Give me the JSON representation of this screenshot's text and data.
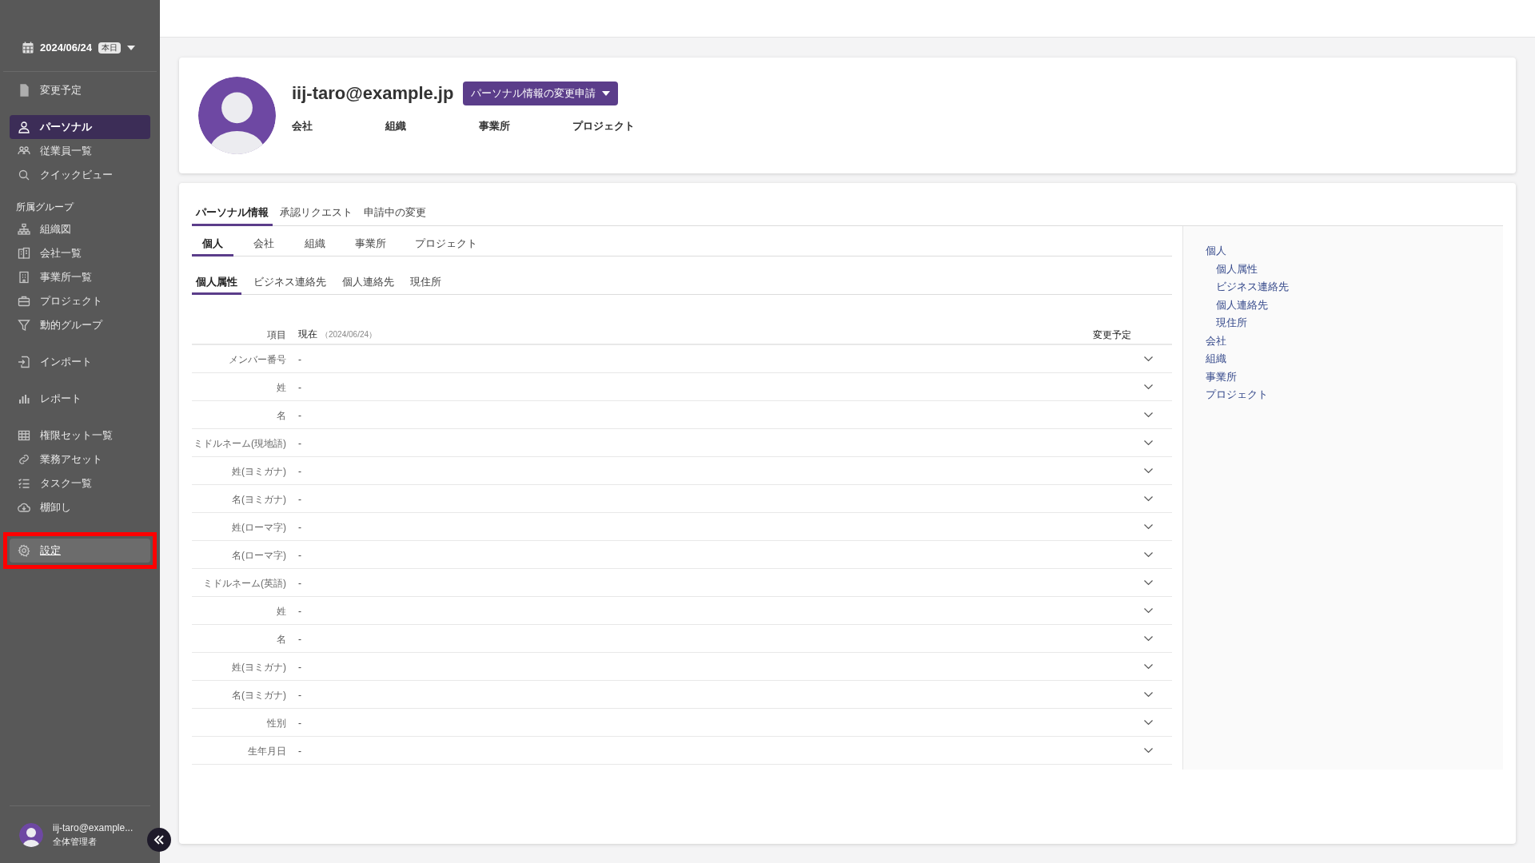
{
  "sidebar": {
    "date": "2024/06/24",
    "today_badge": "本日",
    "groups": [
      {
        "items": [
          {
            "label": "変更予定",
            "kind": "document",
            "selected": false,
            "highlighted": false
          }
        ]
      },
      {
        "items": [
          {
            "label": "パーソナル",
            "kind": "person",
            "selected": true,
            "highlighted": false
          },
          {
            "label": "従業員一覧",
            "kind": "people",
            "selected": false,
            "highlighted": false
          },
          {
            "label": "クイックビュー",
            "kind": "search",
            "selected": false,
            "highlighted": false
          }
        ]
      },
      {
        "heading": "所属グループ",
        "items": [
          {
            "label": "組織図",
            "kind": "org",
            "selected": false,
            "highlighted": false
          },
          {
            "label": "会社一覧",
            "kind": "buildings",
            "selected": false,
            "highlighted": false
          },
          {
            "label": "事業所一覧",
            "kind": "building",
            "selected": false,
            "highlighted": false
          },
          {
            "label": "プロジェクト",
            "kind": "briefcase",
            "selected": false,
            "highlighted": false
          },
          {
            "label": "動的グループ",
            "kind": "filter",
            "selected": false,
            "highlighted": false
          }
        ]
      },
      {
        "items": [
          {
            "label": "インポート",
            "kind": "import",
            "selected": false,
            "highlighted": false
          }
        ]
      },
      {
        "items": [
          {
            "label": "レポート",
            "kind": "chart",
            "selected": false,
            "highlighted": false
          }
        ]
      },
      {
        "items": [
          {
            "label": "権限セット一覧",
            "kind": "grid",
            "selected": false,
            "highlighted": false
          },
          {
            "label": "業務アセット",
            "kind": "link",
            "selected": false,
            "highlighted": false
          },
          {
            "label": "タスク一覧",
            "kind": "tasks",
            "selected": false,
            "highlighted": false
          },
          {
            "label": "棚卸し",
            "kind": "cloud",
            "selected": false,
            "highlighted": false
          }
        ]
      },
      {
        "items": [
          {
            "label": "設定",
            "kind": "gear",
            "selected": false,
            "highlighted": true
          }
        ]
      }
    ],
    "user": {
      "name": "iij-taro@example...",
      "role": "全体管理者"
    }
  },
  "profile": {
    "email": "iij-taro@example.jp",
    "request_button": "パーソナル情報の変更申請",
    "fields": [
      "会社",
      "組織",
      "事業所",
      "プロジェクト"
    ]
  },
  "tabs": [
    {
      "label": "パーソナル情報",
      "selected": true
    },
    {
      "label": "承認リクエスト",
      "selected": false
    },
    {
      "label": "申請中の変更",
      "selected": false
    }
  ],
  "sub_tabs": [
    {
      "label": "個人",
      "selected": true
    },
    {
      "label": "会社",
      "selected": false
    },
    {
      "label": "組織",
      "selected": false
    },
    {
      "label": "事業所",
      "selected": false
    },
    {
      "label": "プロジェクト",
      "selected": false
    }
  ],
  "section_tabs": [
    {
      "label": "個人属性",
      "selected": true
    },
    {
      "label": "ビジネス連絡先",
      "selected": false
    },
    {
      "label": "個人連絡先",
      "selected": false
    },
    {
      "label": "現住所",
      "selected": false
    }
  ],
  "table": {
    "column_item": "項目",
    "column_current": "現在",
    "current_date": "（2024/06/24）",
    "column_planned": "変更予定",
    "rows": [
      {
        "label": "メンバー番号",
        "value": "-"
      },
      {
        "label": "姓",
        "value": "-"
      },
      {
        "label": "名",
        "value": "-"
      },
      {
        "label": "ミドルネーム(現地語)",
        "value": "-"
      },
      {
        "label": "姓(ヨミガナ)",
        "value": "-"
      },
      {
        "label": "名(ヨミガナ)",
        "value": "-"
      },
      {
        "label": "姓(ローマ字)",
        "value": "-"
      },
      {
        "label": "名(ローマ字)",
        "value": "-"
      },
      {
        "label": "ミドルネーム(英語)",
        "value": "-"
      },
      {
        "label": "姓",
        "value": "-"
      },
      {
        "label": "名",
        "value": "-"
      },
      {
        "label": "姓(ヨミガナ)",
        "value": "-"
      },
      {
        "label": "名(ヨミガナ)",
        "value": "-"
      },
      {
        "label": "性別",
        "value": "-"
      },
      {
        "label": "生年月日",
        "value": "-"
      }
    ]
  },
  "outline": [
    {
      "label": "個人",
      "children": [
        {
          "label": "個人属性"
        },
        {
          "label": "ビジネス連絡先"
        },
        {
          "label": "個人連絡先"
        },
        {
          "label": "現住所"
        }
      ]
    },
    {
      "label": "会社"
    },
    {
      "label": "組織"
    },
    {
      "label": "事業所"
    },
    {
      "label": "プロジェクト"
    }
  ]
}
